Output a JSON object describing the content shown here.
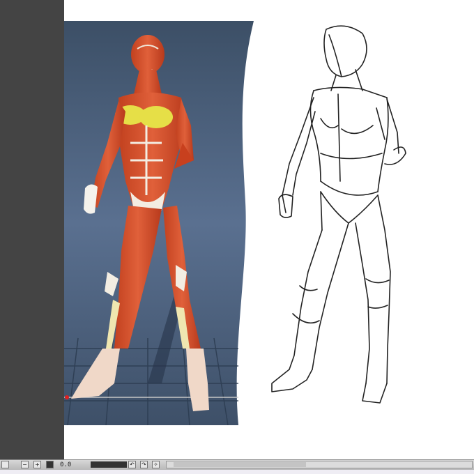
{
  "app": {
    "accent_colors": {
      "panel": "#444444",
      "reference_bg": "#4a5d76",
      "muscle": "#d8542e",
      "highlight": "#e8e04a",
      "sketch_line": "#222222"
    }
  },
  "canvas": {
    "reference_image": "muscle-anatomy-3d-figure",
    "sketch_image": "pencil-figure-drawing"
  },
  "statusbar": {
    "zoom_out_icon": "zoom-out-icon",
    "zoom_in_icon": "zoom-in-icon",
    "fit_icon": "fit-screen-icon",
    "zoom_value": "0.0",
    "rotate_left_icon": "rotate-left-icon",
    "rotate_right_icon": "rotate-right-icon",
    "reset_icon": "reset-rotation-icon"
  }
}
